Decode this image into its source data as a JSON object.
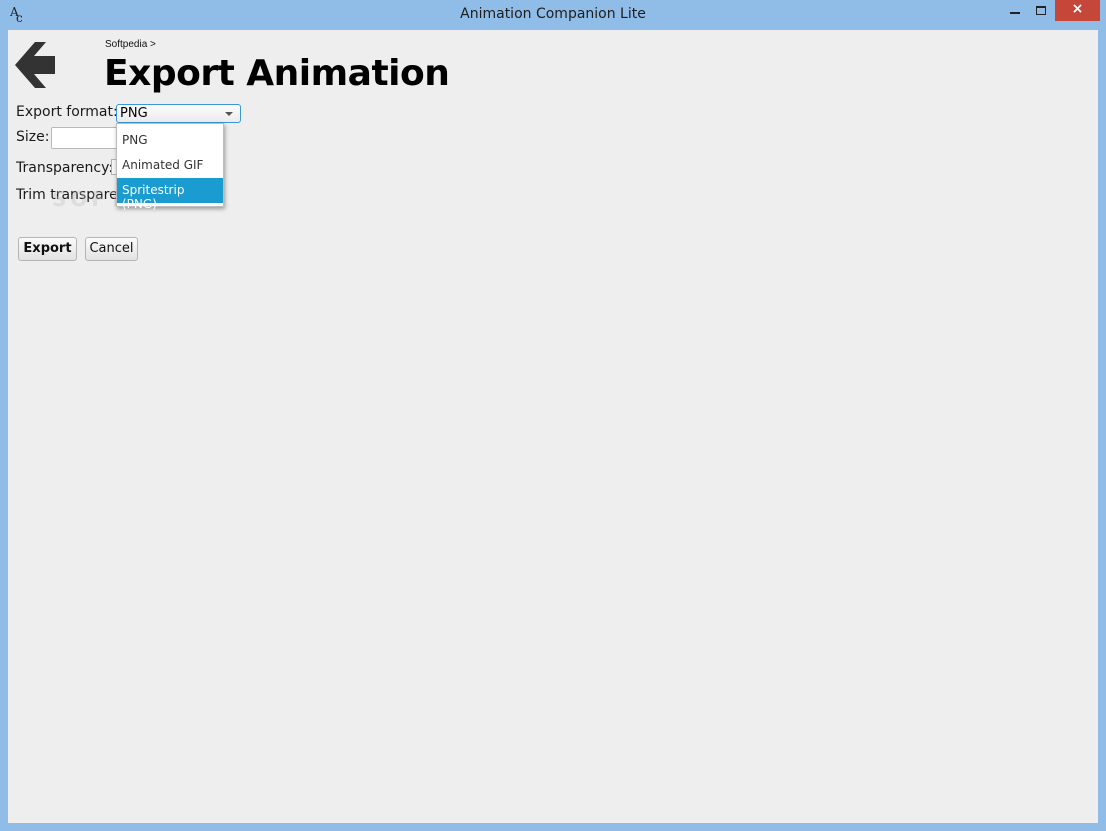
{
  "window": {
    "title": "Animation Companion Lite",
    "app_icon": "AC-logo-icon",
    "controls": {
      "minimize": "minimize-icon",
      "maximize": "maximize-icon",
      "close": "×"
    }
  },
  "header": {
    "back_icon": "back-arrow-icon",
    "breadcrumb": "Softpedia >",
    "title": "Export Animation"
  },
  "form": {
    "export_format_label": "Export format:",
    "export_format_value": "PNG",
    "size_label": "Size:",
    "size_value": "",
    "transparency_label": "Transparency:",
    "trim_label": "Trim transparen"
  },
  "dropdown": {
    "options": [
      {
        "label": "PNG",
        "selected": false
      },
      {
        "label": "Animated GIF",
        "selected": false
      },
      {
        "label": "Spritestrip (PNG)",
        "selected": true
      }
    ]
  },
  "buttons": {
    "export": "Export",
    "cancel": "Cancel"
  },
  "watermark": "SOFTPEDIA",
  "colors": {
    "titlebar": "#8fbde8",
    "close": "#c7463a",
    "selection": "#1b9cd0",
    "combo_border": "#3a96d6",
    "background": "#eeeeee"
  }
}
